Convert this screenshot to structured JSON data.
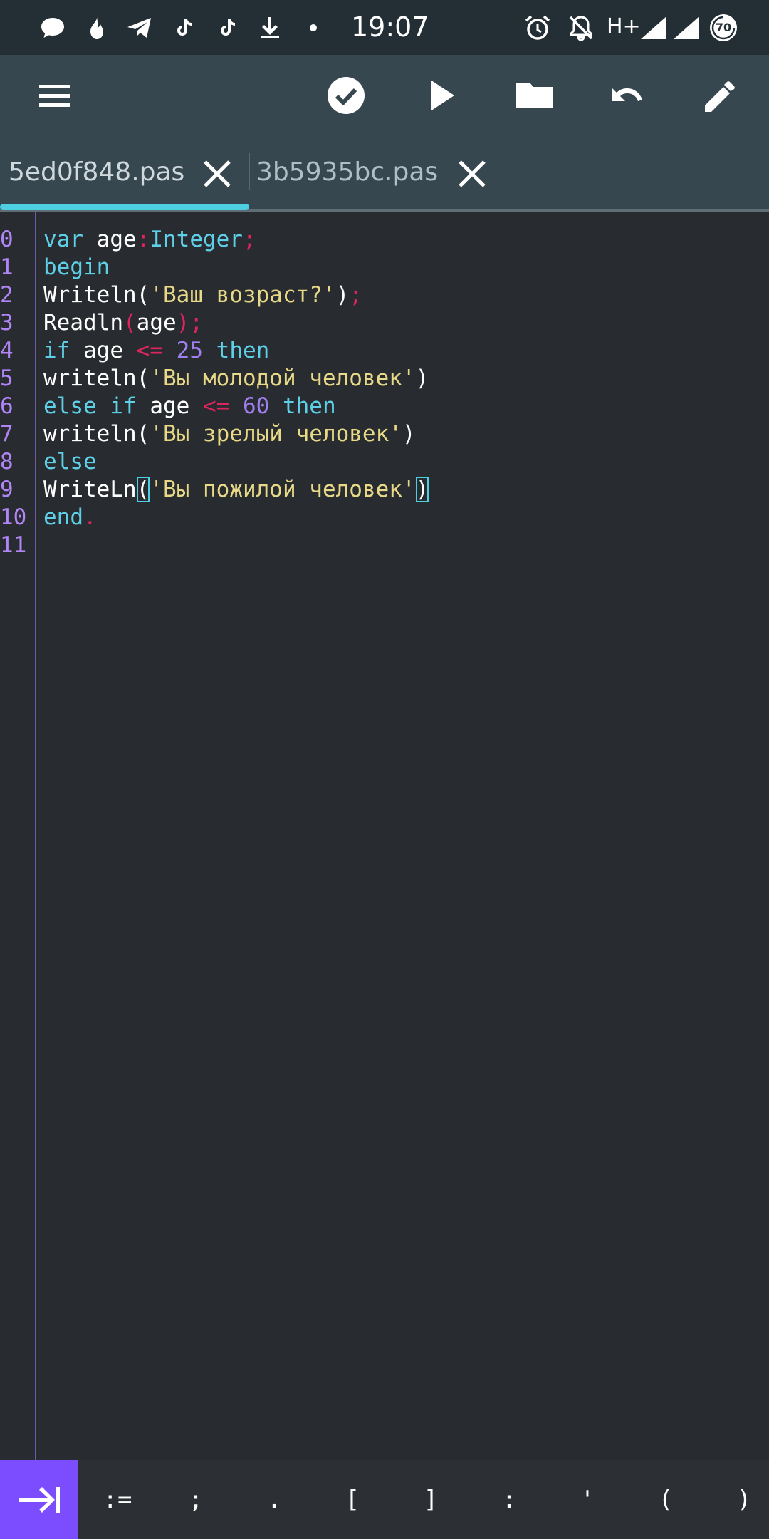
{
  "status_bar": {
    "time": "19:07",
    "network": "H+",
    "battery": "70",
    "icons_left": [
      "chat-bubble-icon",
      "flame-icon",
      "telegram-icon",
      "tiktok-icon",
      "tiktok-icon",
      "download-icon",
      "dot-icon"
    ],
    "icons_right": [
      "alarm-icon",
      "bell-off-icon",
      "signal-icon",
      "signal-icon",
      "battery-saver-icon"
    ]
  },
  "toolbar": {
    "icons": [
      "menu-icon",
      "check-circle-icon",
      "play-icon",
      "folder-icon",
      "undo-icon",
      "pencil-icon"
    ]
  },
  "tabs": [
    {
      "label": "5ed0f848.pas",
      "active": true
    },
    {
      "label": "3b5935bc.pas",
      "active": false
    }
  ],
  "editor": {
    "line_numbers": [
      "0",
      "1",
      "2",
      "3",
      "4",
      "5",
      "6",
      "7",
      "8",
      "9",
      "10",
      "11"
    ],
    "lines": [
      [
        {
          "t": "kw",
          "v": "var"
        },
        {
          "t": "id",
          "v": " age"
        },
        {
          "t": "op",
          "v": ":"
        },
        {
          "t": "kw",
          "v": "Integer"
        },
        {
          "t": "op",
          "v": ";"
        }
      ],
      [
        {
          "t": "kw",
          "v": "begin"
        }
      ],
      [
        {
          "t": "id",
          "v": "Writeln("
        },
        {
          "t": "str",
          "v": "'Ваш возраст?'"
        },
        {
          "t": "id",
          "v": ")"
        },
        {
          "t": "op",
          "v": ";"
        }
      ],
      [
        {
          "t": "id",
          "v": "Readln"
        },
        {
          "t": "op",
          "v": "("
        },
        {
          "t": "id",
          "v": "age"
        },
        {
          "t": "op",
          "v": ");"
        }
      ],
      [
        {
          "t": "kw",
          "v": "if"
        },
        {
          "t": "id",
          "v": " age "
        },
        {
          "t": "op",
          "v": "<="
        },
        {
          "t": "id",
          "v": " "
        },
        {
          "t": "num",
          "v": "25"
        },
        {
          "t": "id",
          "v": " "
        },
        {
          "t": "kw",
          "v": "then"
        }
      ],
      [
        {
          "t": "id",
          "v": "writeln("
        },
        {
          "t": "str",
          "v": "'Вы молодой человек'"
        },
        {
          "t": "id",
          "v": ")"
        }
      ],
      [
        {
          "t": "kw",
          "v": "else"
        },
        {
          "t": "id",
          "v": " "
        },
        {
          "t": "kw",
          "v": "if"
        },
        {
          "t": "id",
          "v": " age "
        },
        {
          "t": "op",
          "v": "<="
        },
        {
          "t": "id",
          "v": " "
        },
        {
          "t": "num",
          "v": "60"
        },
        {
          "t": "id",
          "v": " "
        },
        {
          "t": "kw",
          "v": "then"
        }
      ],
      [
        {
          "t": "id",
          "v": "writeln("
        },
        {
          "t": "str",
          "v": "'Вы зрелый человек'"
        },
        {
          "t": "id",
          "v": ")"
        }
      ],
      [
        {
          "t": "kw",
          "v": "else"
        }
      ],
      [
        {
          "t": "id",
          "v": "WriteLn"
        },
        {
          "t": "br",
          "v": "("
        },
        {
          "t": "str",
          "v": "'Вы пожилой человек'"
        },
        {
          "t": "br",
          "v": ")"
        }
      ],
      [
        {
          "t": "kw",
          "v": "end"
        },
        {
          "t": "op",
          "v": "."
        }
      ],
      []
    ]
  },
  "extra_keys": {
    "tab_icon": "tab-arrow-icon",
    "keys": [
      ":=",
      ";",
      ".",
      "[",
      "]",
      ":",
      "'",
      "(",
      ")"
    ]
  }
}
